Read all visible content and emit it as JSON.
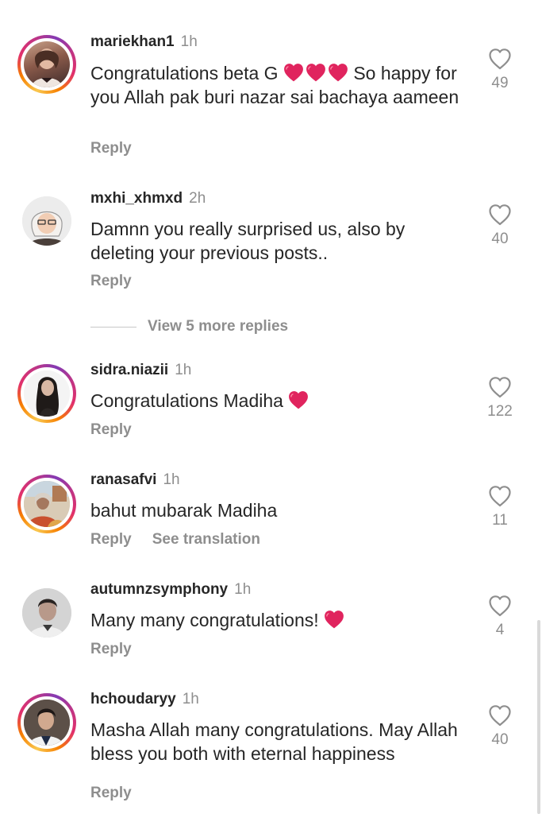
{
  "comments": [
    {
      "username": "mariekhan1",
      "time": "1h",
      "text_parts": [
        "Congratulations beta G ",
        " So happy for you Allah pak buri nazar sai bachaya aameen"
      ],
      "likes": "49",
      "reply": "Reply",
      "avatar_ring": true
    },
    {
      "username": "mxhi_xhmxd",
      "time": "2h",
      "text": "Damnn you really surprised us, also by deleting your previous posts..",
      "likes": "40",
      "reply": "Reply",
      "avatar_ring": false
    },
    {
      "username": "sidra.niazii",
      "time": "1h",
      "text": "Congratulations Madiha ",
      "likes": "122",
      "reply": "Reply",
      "avatar_ring": true
    },
    {
      "username": "ranasafvi",
      "time": "1h",
      "text": "bahut mubarak Madiha",
      "likes": "11",
      "reply": "Reply",
      "see_translation": "See translation",
      "avatar_ring": true
    },
    {
      "username": "autumnzsymphony",
      "time": "1h",
      "text": "Many many congratulations! ",
      "likes": "4",
      "reply": "Reply",
      "avatar_ring": false
    },
    {
      "username": "hchoudaryy",
      "time": "1h",
      "text": "Masha Allah many congratulations. May Allah bless you both with eternal happiness",
      "likes": "40",
      "reply": "Reply",
      "avatar_ring": true
    }
  ],
  "view_more_replies": "View 5 more replies",
  "colors": {
    "text": "#262626",
    "secondary": "#8e8e8e",
    "heart_emoji": "#e0245e"
  },
  "icons": {
    "like": "heart-outline-icon",
    "emoji": "red-heart-emoji"
  }
}
